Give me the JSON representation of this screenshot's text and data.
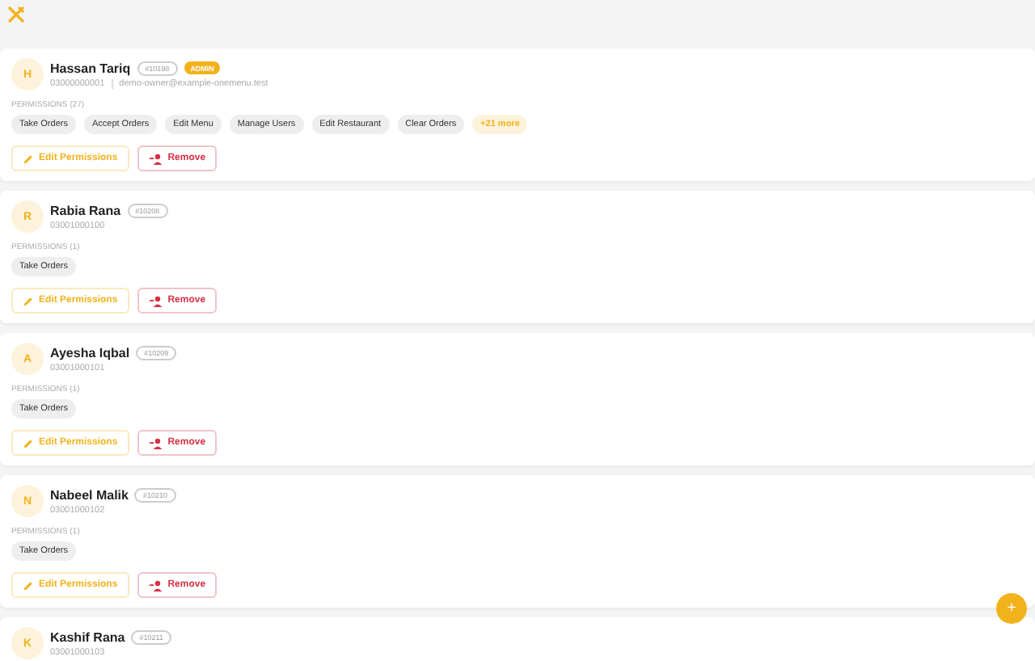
{
  "users": [
    {
      "initial": "H",
      "name": "Hassan Tariq",
      "id": "#10198",
      "role": "ADMIN",
      "phone": "03000000001",
      "email": "demo-owner@example-onemenu.test",
      "permissions_label": "PERMISSIONS (27)",
      "permissions": [
        "Take Orders",
        "Accept Orders",
        "Edit Menu",
        "Manage Users",
        "Edit Restaurant",
        "Clear Orders"
      ],
      "more": "+21 more",
      "actions": [
        "Edit Permissions",
        "Remove"
      ]
    },
    {
      "initial": "R",
      "name": "Rabia Rana",
      "id": "#10208",
      "phone": "03001000100",
      "permissions_label": "PERMISSIONS (1)",
      "permissions": [
        "Take Orders"
      ],
      "actions": [
        "Edit Permissions",
        "Remove"
      ]
    },
    {
      "initial": "A",
      "name": "Ayesha Iqbal",
      "id": "#10209",
      "phone": "03001000101",
      "permissions_label": "PERMISSIONS (1)",
      "permissions": [
        "Take Orders"
      ],
      "actions": [
        "Edit Permissions",
        "Remove"
      ]
    },
    {
      "initial": "N",
      "name": "Nabeel Malik",
      "id": "#10210",
      "phone": "03001000102",
      "permissions_label": "PERMISSIONS (1)",
      "permissions": [
        "Take Orders"
      ],
      "actions": [
        "Edit Permissions",
        "Remove"
      ]
    },
    {
      "initial": "K",
      "name": "Kashif Rana",
      "id": "#10211",
      "phone": "03001000103"
    }
  ],
  "fab": {
    "label": "+"
  }
}
